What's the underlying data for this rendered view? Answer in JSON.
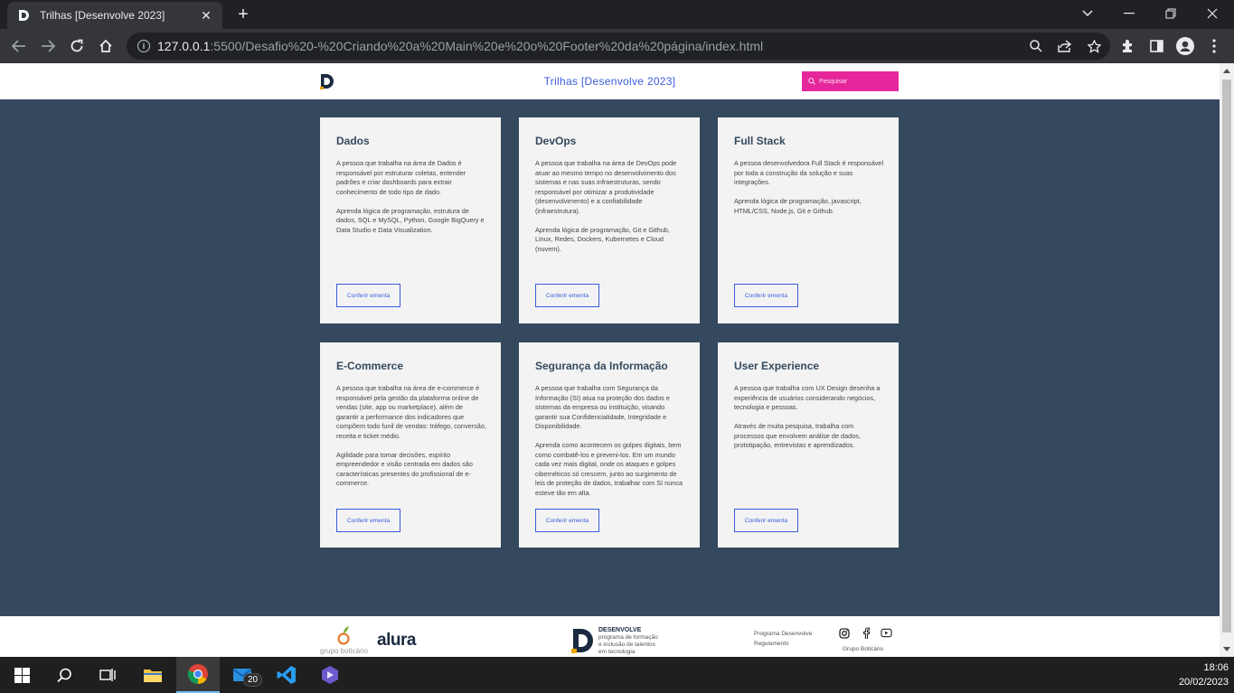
{
  "browser": {
    "tab_title": "Trilhas [Desenvolve 2023]",
    "url_host": "127.0.0.1",
    "url_rest": ":5500/Desafio%20-%20Criando%20a%20Main%20e%20o%20Footer%20da%20página/index.html"
  },
  "header": {
    "title": "Trilhas [Desenvolve 2023]",
    "search_placeholder": "Pesquisar"
  },
  "cards": [
    {
      "title": "Dados",
      "paragraphs": [
        "A pessoa que trabalha na área de Dados é responsável por estruturar coletas, entender padrões e criar dashboards para extrair conhecimento de todo tipo de dado.",
        "Aprenda lógica de programação, estrutura de dados, SQL e MySQL, Python, Google BigQuery e Data Studio e Data Visualization."
      ],
      "button": "Conferir ementa"
    },
    {
      "title": "DevOps",
      "paragraphs": [
        "A pessoa que trabalha na área de DevOps pode atuar ao mesmo tempo no desenvolvimento dos sistemas e nas suas infraestruturas, sendo responsável por otimizar a produtividade (desenvolvimento) e a confiabilidade (infraestrutura).",
        "Aprenda lógica de programação, Git e Github, Linux, Redes, Dockers, Kubernetes e Cloud (nuvem)."
      ],
      "button": "Conferir ementa"
    },
    {
      "title": "Full Stack",
      "paragraphs": [
        "A pessoa desenvolvedora Full Stack é responsável por toda a construção da solução e suas integrações.",
        "Aprenda lógica de programação, javascript, HTML/CSS, Node.js, Git e Github."
      ],
      "button": "Conferir ementa"
    },
    {
      "title": "E-Commerce",
      "paragraphs": [
        "A pessoa que trabalha na área de e-commerce é responsável pela gestão da plataforma online de vendas (site, app ou marketplace), além de garantir a performance dos indicadores que compõem todo funil de vendas: tráfego, conversão, receita e ticket médio.",
        "Agilidade para tomar decisões, espírito empreendedor e visão centrada em dados são características presentes do profissional de e-commerce."
      ],
      "button": "Conferir ementa"
    },
    {
      "title": "Segurança da Informação",
      "paragraphs": [
        "A pessoa que trabalha com Segurança da Informação (SI) atua na proteção dos dados e sistemas da empresa ou instituição, visando garantir sua Confidencialidade, Integridade e Disponibilidade.",
        "Aprenda como acontecem os golpes digitais, bem como combatê-los e preveni-los. Em um mundo cada vez mais digital, onde os ataques e golpes cibernéticos só crescem, junto ao surgimento de leis de proteção de dados, trabalhar com SI nunca esteve tão em alta."
      ],
      "button": "Conferir ementa"
    },
    {
      "title": "User Experience",
      "paragraphs": [
        "A pessoa que trabalha com UX Design desenha a experiência de usuários considerando negócios, tecnologia e pessoas.",
        "Através de muita pesquisa, trabalha com processos que envolvem análise de dados, prototipação, entrevistas e aprendizados."
      ],
      "button": "Conferir ementa"
    }
  ],
  "footer": {
    "grupo_boticario_logo_text": "grupo boticário",
    "alura_logo_text": "alura",
    "desenvolve_title": "DESENVOLVE",
    "desenvolve_tagline_1": "programa de formação",
    "desenvolve_tagline_2": "e inclusão de talentos",
    "desenvolve_tagline_3": "em tecnologia",
    "link_program": "Programa Desenvolve",
    "link_rules": "Regulamento",
    "social_caption": "Grupo Boticário"
  },
  "taskbar": {
    "mail_badge": "20",
    "time": "18:06",
    "date": "20/02/2023"
  },
  "colors": {
    "page_bg": "#34495e",
    "accent_pink": "#e5279b",
    "accent_blue": "#3b5bdb",
    "card_bg": "#f3f3f3"
  }
}
